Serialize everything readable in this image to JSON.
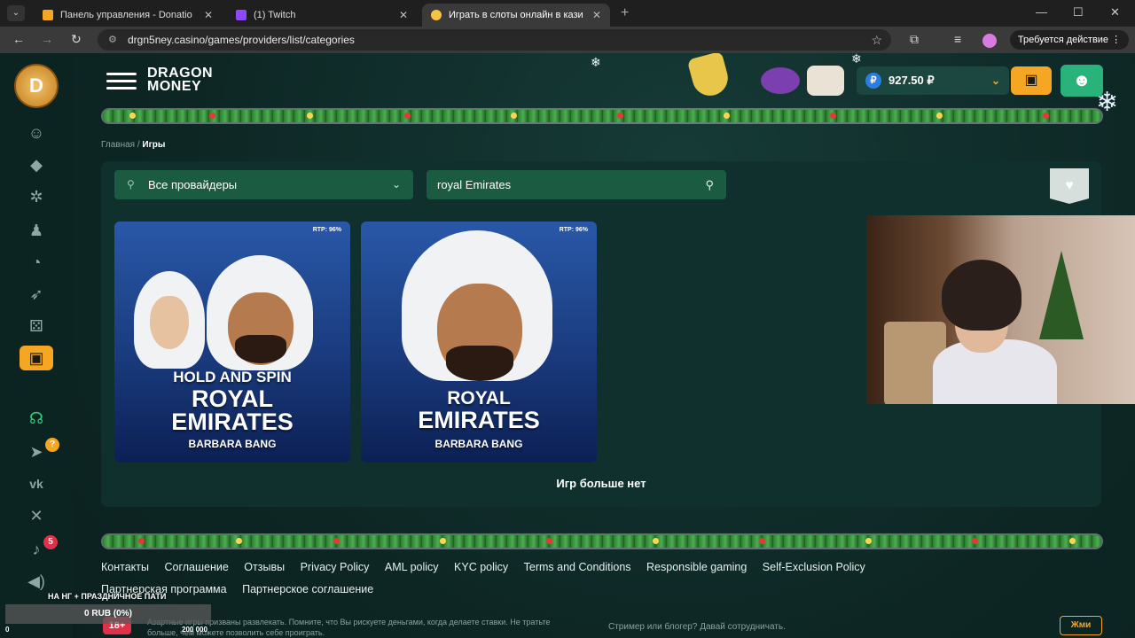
{
  "browser": {
    "tabs": [
      {
        "title": "Панель управления - Donatio",
        "fav_color": "#f5a623",
        "active": false
      },
      {
        "title": "(1) Twitch",
        "fav_color": "#9146ff",
        "active": false
      },
      {
        "title": "Играть в слоты онлайн в кази",
        "fav_color": "#f5c542",
        "active": true
      }
    ],
    "url": "drgn5ney.casino/games/providers/list/categories",
    "action_label": "Требуется действие"
  },
  "header": {
    "brand_line1": "DRAGON",
    "brand_line2": "MONEY",
    "balance": "927.50 ₽",
    "currency_symbol": "₽"
  },
  "sidebar": {
    "telegram_badge": "?",
    "notifications_badge": "5"
  },
  "breadcrumb": {
    "home": "Главная",
    "separator": "/",
    "current": "Игры"
  },
  "filters": {
    "provider_selected": "Все провайдеры",
    "search_value": "royal Emirates"
  },
  "games": [
    {
      "rtp": "RTP: 96%",
      "line1": "HOLD AND SPIN",
      "line2": "ROYAL",
      "line3": "EMIRATES",
      "provider": "BARBARA BANG"
    },
    {
      "rtp": "RTP: 96%",
      "line1": "",
      "line2": "ROYAL",
      "line3": "EMIRATES",
      "provider": "BARBARA BANG"
    }
  ],
  "no_more_games": "Игр больше нет",
  "footer": {
    "links": [
      "Контакты",
      "Соглашение",
      "Отзывы",
      "Privacy Policy",
      "AML policy",
      "KYC policy",
      "Terms and Conditions",
      "Responsible gaming",
      "Self-Exclusion Policy",
      "Партнерская программа",
      "Партнерское соглашение"
    ],
    "age": "18+",
    "disclaimer": "Азартные игры призваны развлекать. Помните, что Вы рискуете деньгами, когда делаете ставки. Не тратьте больше, чем можете позволить себе проиграть.",
    "partner_text": "Стример или блогер? Давай сотрудничать.",
    "press_button": "Жми"
  },
  "stream_overlay": {
    "goal_title": "НА НГ + ПРАЗДНИЧНОЕ ПАТИ",
    "goal_progress": "0 RUB (0%)",
    "goal_min": "0",
    "goal_max": "200 000",
    "progress_fraction": 0
  }
}
